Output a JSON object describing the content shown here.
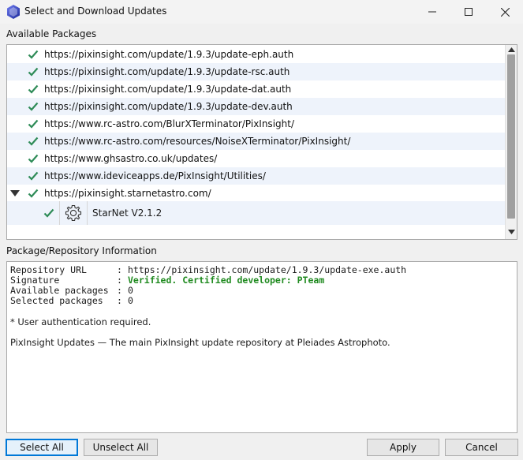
{
  "window": {
    "title": "Select and Download Updates",
    "accent": "#0078d7"
  },
  "sections": {
    "available_packages": "Available Packages",
    "info": "Package/Repository Information"
  },
  "repositories": [
    {
      "url": "https://pixinsight.com/update/1.9.3/update-eph.auth",
      "checked": true
    },
    {
      "url": "https://pixinsight.com/update/1.9.3/update-rsc.auth",
      "checked": true
    },
    {
      "url": "https://pixinsight.com/update/1.9.3/update-dat.auth",
      "checked": true
    },
    {
      "url": "https://pixinsight.com/update/1.9.3/update-dev.auth",
      "checked": true
    },
    {
      "url": "https://www.rc-astro.com/BlurXTerminator/PixInsight/",
      "checked": true
    },
    {
      "url": "https://www.rc-astro.com/resources/NoiseXTerminator/PixInsight/",
      "checked": true
    },
    {
      "url": "https://www.ghsastro.co.uk/updates/",
      "checked": true
    },
    {
      "url": "https://www.ideviceapps.de/PixInsight/Utilities/",
      "checked": true
    },
    {
      "url": "https://pixinsight.starnetastro.com/",
      "checked": true,
      "expanded": true
    }
  ],
  "child_package": {
    "name": "StarNet V2.1.2",
    "icon": "gear-icon",
    "checked": true
  },
  "info": {
    "repository_url_label": "Repository URL",
    "repository_url_value": "https://pixinsight.com/update/1.9.3/update-exe.auth",
    "signature_label": "Signature",
    "signature_value": "Verified. Certified developer: PTeam",
    "available_label": "Available packages",
    "available_value": "0",
    "selected_label": "Selected packages",
    "selected_value": "0",
    "separator": ":",
    "auth_note": "* User authentication required.",
    "description": "PixInsight Updates — The main PixInsight update repository at Pleiades Astrophoto."
  },
  "buttons": {
    "select_all": "Select All",
    "unselect_all": "Unselect All",
    "apply": "Apply",
    "cancel": "Cancel"
  },
  "colors": {
    "check": "#2e8b57",
    "verified": "#1f8a1f",
    "alt_row": "#eef3fb"
  }
}
